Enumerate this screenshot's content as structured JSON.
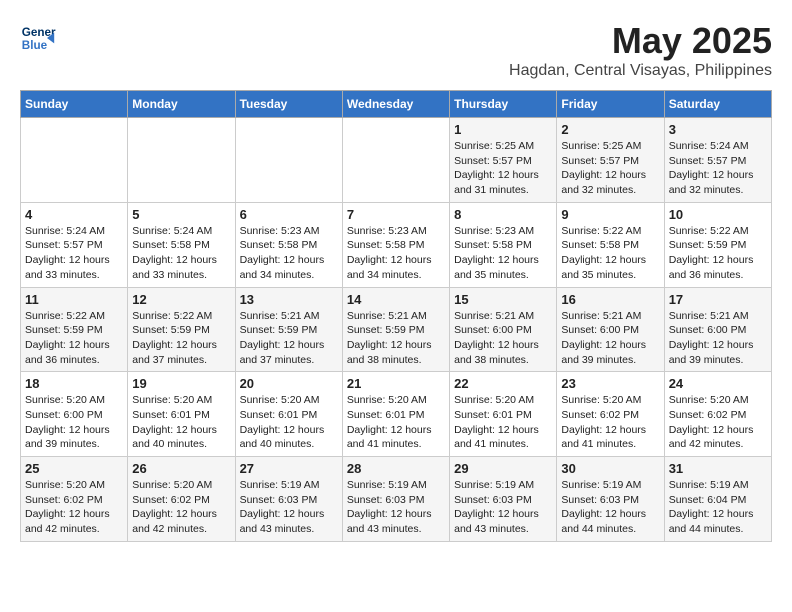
{
  "header": {
    "logo_line1": "General",
    "logo_line2": "Blue",
    "title": "May 2025",
    "subtitle": "Hagdan, Central Visayas, Philippines"
  },
  "weekdays": [
    "Sunday",
    "Monday",
    "Tuesday",
    "Wednesday",
    "Thursday",
    "Friday",
    "Saturday"
  ],
  "weeks": [
    [
      {
        "day": "",
        "content": ""
      },
      {
        "day": "",
        "content": ""
      },
      {
        "day": "",
        "content": ""
      },
      {
        "day": "",
        "content": ""
      },
      {
        "day": "1",
        "content": "Sunrise: 5:25 AM\nSunset: 5:57 PM\nDaylight: 12 hours\nand 31 minutes."
      },
      {
        "day": "2",
        "content": "Sunrise: 5:25 AM\nSunset: 5:57 PM\nDaylight: 12 hours\nand 32 minutes."
      },
      {
        "day": "3",
        "content": "Sunrise: 5:24 AM\nSunset: 5:57 PM\nDaylight: 12 hours\nand 32 minutes."
      }
    ],
    [
      {
        "day": "4",
        "content": "Sunrise: 5:24 AM\nSunset: 5:57 PM\nDaylight: 12 hours\nand 33 minutes."
      },
      {
        "day": "5",
        "content": "Sunrise: 5:24 AM\nSunset: 5:58 PM\nDaylight: 12 hours\nand 33 minutes."
      },
      {
        "day": "6",
        "content": "Sunrise: 5:23 AM\nSunset: 5:58 PM\nDaylight: 12 hours\nand 34 minutes."
      },
      {
        "day": "7",
        "content": "Sunrise: 5:23 AM\nSunset: 5:58 PM\nDaylight: 12 hours\nand 34 minutes."
      },
      {
        "day": "8",
        "content": "Sunrise: 5:23 AM\nSunset: 5:58 PM\nDaylight: 12 hours\nand 35 minutes."
      },
      {
        "day": "9",
        "content": "Sunrise: 5:22 AM\nSunset: 5:58 PM\nDaylight: 12 hours\nand 35 minutes."
      },
      {
        "day": "10",
        "content": "Sunrise: 5:22 AM\nSunset: 5:59 PM\nDaylight: 12 hours\nand 36 minutes."
      }
    ],
    [
      {
        "day": "11",
        "content": "Sunrise: 5:22 AM\nSunset: 5:59 PM\nDaylight: 12 hours\nand 36 minutes."
      },
      {
        "day": "12",
        "content": "Sunrise: 5:22 AM\nSunset: 5:59 PM\nDaylight: 12 hours\nand 37 minutes."
      },
      {
        "day": "13",
        "content": "Sunrise: 5:21 AM\nSunset: 5:59 PM\nDaylight: 12 hours\nand 37 minutes."
      },
      {
        "day": "14",
        "content": "Sunrise: 5:21 AM\nSunset: 5:59 PM\nDaylight: 12 hours\nand 38 minutes."
      },
      {
        "day": "15",
        "content": "Sunrise: 5:21 AM\nSunset: 6:00 PM\nDaylight: 12 hours\nand 38 minutes."
      },
      {
        "day": "16",
        "content": "Sunrise: 5:21 AM\nSunset: 6:00 PM\nDaylight: 12 hours\nand 39 minutes."
      },
      {
        "day": "17",
        "content": "Sunrise: 5:21 AM\nSunset: 6:00 PM\nDaylight: 12 hours\nand 39 minutes."
      }
    ],
    [
      {
        "day": "18",
        "content": "Sunrise: 5:20 AM\nSunset: 6:00 PM\nDaylight: 12 hours\nand 39 minutes."
      },
      {
        "day": "19",
        "content": "Sunrise: 5:20 AM\nSunset: 6:01 PM\nDaylight: 12 hours\nand 40 minutes."
      },
      {
        "day": "20",
        "content": "Sunrise: 5:20 AM\nSunset: 6:01 PM\nDaylight: 12 hours\nand 40 minutes."
      },
      {
        "day": "21",
        "content": "Sunrise: 5:20 AM\nSunset: 6:01 PM\nDaylight: 12 hours\nand 41 minutes."
      },
      {
        "day": "22",
        "content": "Sunrise: 5:20 AM\nSunset: 6:01 PM\nDaylight: 12 hours\nand 41 minutes."
      },
      {
        "day": "23",
        "content": "Sunrise: 5:20 AM\nSunset: 6:02 PM\nDaylight: 12 hours\nand 41 minutes."
      },
      {
        "day": "24",
        "content": "Sunrise: 5:20 AM\nSunset: 6:02 PM\nDaylight: 12 hours\nand 42 minutes."
      }
    ],
    [
      {
        "day": "25",
        "content": "Sunrise: 5:20 AM\nSunset: 6:02 PM\nDaylight: 12 hours\nand 42 minutes."
      },
      {
        "day": "26",
        "content": "Sunrise: 5:20 AM\nSunset: 6:02 PM\nDaylight: 12 hours\nand 42 minutes."
      },
      {
        "day": "27",
        "content": "Sunrise: 5:19 AM\nSunset: 6:03 PM\nDaylight: 12 hours\nand 43 minutes."
      },
      {
        "day": "28",
        "content": "Sunrise: 5:19 AM\nSunset: 6:03 PM\nDaylight: 12 hours\nand 43 minutes."
      },
      {
        "day": "29",
        "content": "Sunrise: 5:19 AM\nSunset: 6:03 PM\nDaylight: 12 hours\nand 43 minutes."
      },
      {
        "day": "30",
        "content": "Sunrise: 5:19 AM\nSunset: 6:03 PM\nDaylight: 12 hours\nand 44 minutes."
      },
      {
        "day": "31",
        "content": "Sunrise: 5:19 AM\nSunset: 6:04 PM\nDaylight: 12 hours\nand 44 minutes."
      }
    ]
  ]
}
